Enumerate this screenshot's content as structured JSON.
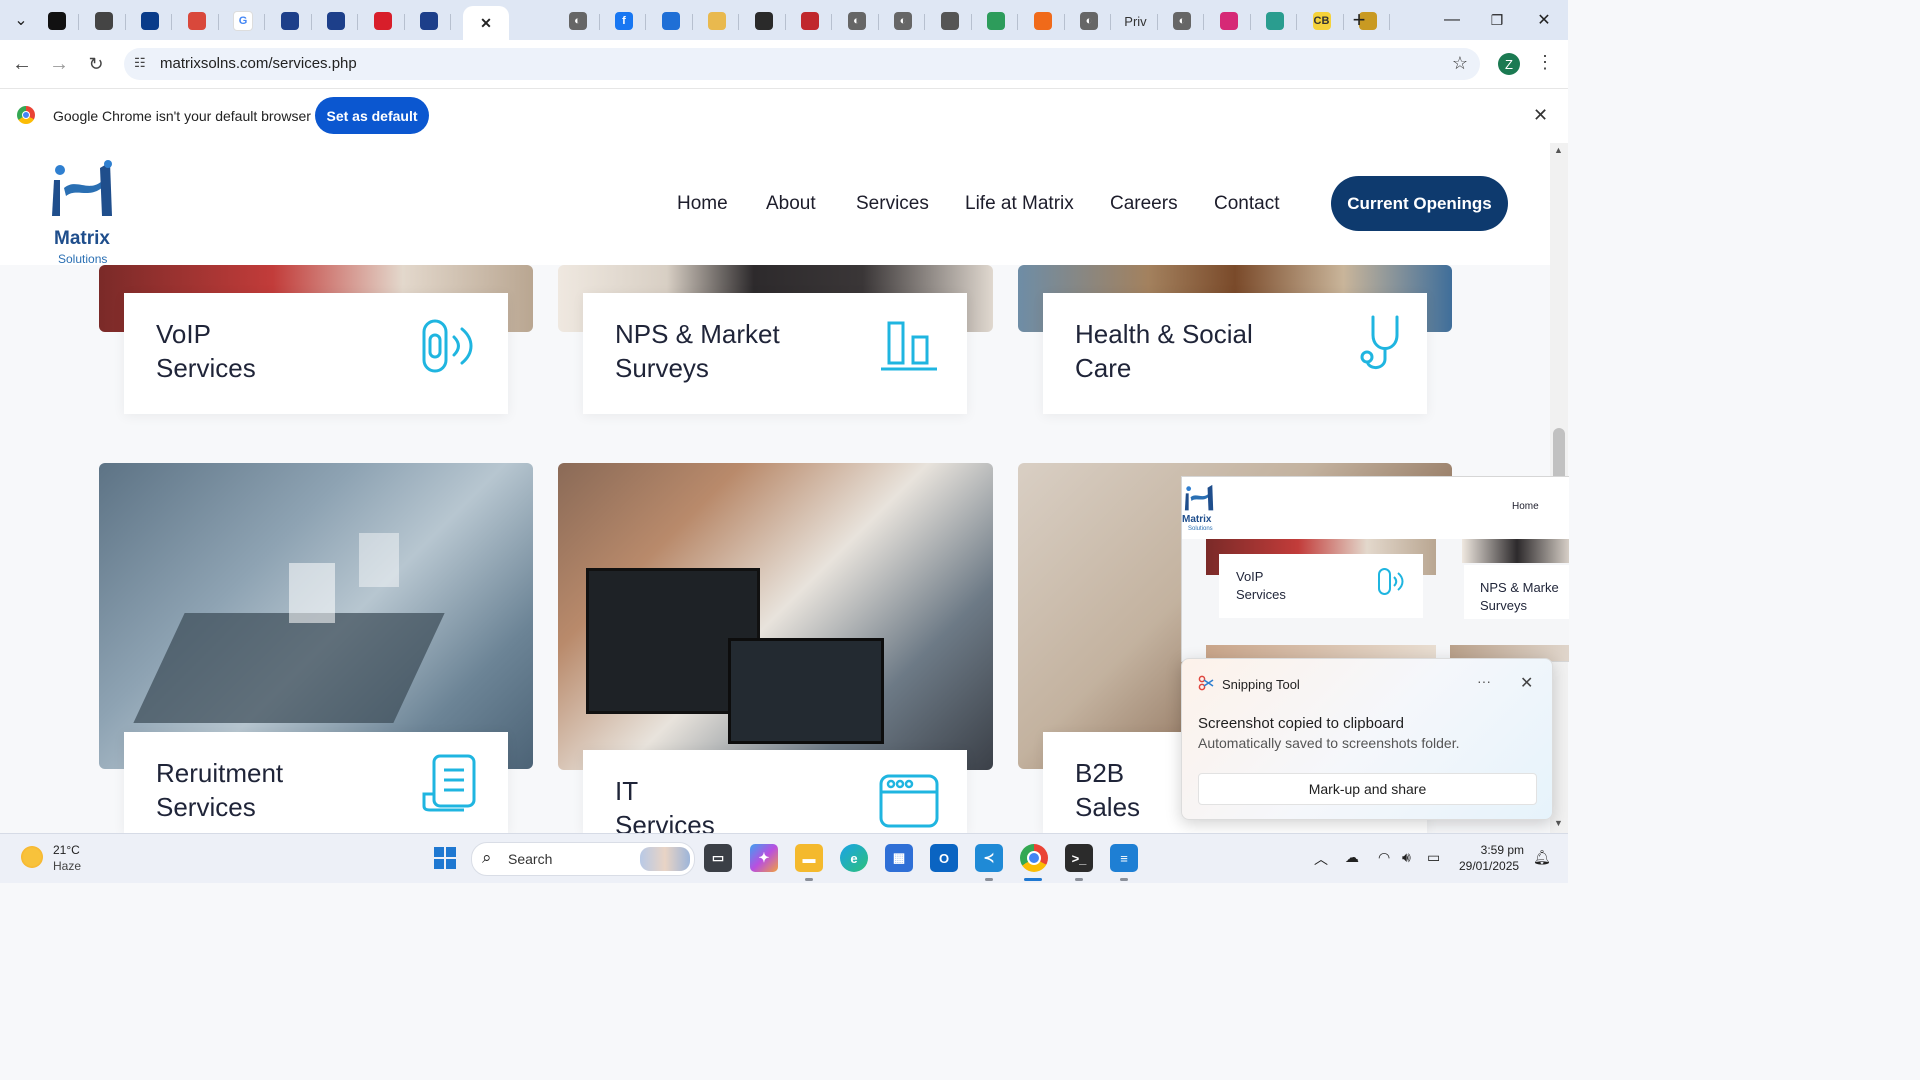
{
  "browser": {
    "tabs": [
      {
        "icon": "chatgpt-icon"
      },
      {
        "icon": "openai-icon"
      },
      {
        "icon": "meta-icon"
      },
      {
        "icon": "puzzle-icon"
      },
      {
        "icon": "google-icon"
      },
      {
        "icon": "copilot-icon"
      },
      {
        "icon": "copilot-icon"
      },
      {
        "icon": "red-app-icon"
      },
      {
        "icon": "copilot-icon"
      },
      {
        "icon": "close-icon",
        "active": true
      },
      {
        "icon": "globe-icon"
      },
      {
        "icon": "facebook-icon"
      },
      {
        "icon": "accessibility-icon"
      },
      {
        "icon": "brand-icon"
      },
      {
        "icon": "calligraphy-icon"
      },
      {
        "icon": "calendar-icon"
      },
      {
        "icon": "globe-icon"
      },
      {
        "icon": "globe-icon"
      },
      {
        "icon": "loading-icon"
      },
      {
        "icon": "map-icon"
      },
      {
        "icon": "orange-app-icon"
      },
      {
        "icon": "globe-icon"
      },
      {
        "icon": "privacy-icon",
        "label": "Priv"
      },
      {
        "icon": "globe-icon"
      },
      {
        "icon": "instagram-icon"
      },
      {
        "icon": "app-icon"
      },
      {
        "icon": "cb-icon",
        "label": "CB"
      },
      {
        "icon": "bird-icon"
      }
    ],
    "url": "matrixsolns.com/services.php",
    "profile_initial": "Z",
    "infobar": {
      "message": "Google Chrome isn't your default browser",
      "button": "Set as default"
    }
  },
  "site": {
    "logo_word": "Matrix",
    "logo_sub": "Solutions",
    "nav": [
      "Home",
      "About",
      "Services",
      "Life at Matrix",
      "Careers",
      "Contact"
    ],
    "cta": "Current Openings",
    "services": [
      {
        "title": "VoIP\nServices",
        "icon": "phone-signal-icon"
      },
      {
        "title": "NPS & Market\nSurveys",
        "icon": "bar-chart-icon"
      },
      {
        "title": "Health & Social\nCare",
        "icon": "stethoscope-icon"
      },
      {
        "title": "Reruitment\nServices",
        "icon": "document-icon"
      },
      {
        "title": "IT\nServices",
        "icon": "browser-window-icon"
      },
      {
        "title": "B2B\nSales",
        "icon": ""
      }
    ]
  },
  "snip_preview": {
    "nav_home": "Home",
    "card1": "VoIP\nServices",
    "card2": "NPS & Marke\nSurveys"
  },
  "toast": {
    "app": "Snipping Tool",
    "more": "···",
    "heading": "Screenshot copied to clipboard",
    "subtext": "Automatically saved to screenshots folder.",
    "button": "Mark-up and share"
  },
  "taskbar": {
    "temperature": "21°C",
    "weather": "Haze",
    "search": "Search",
    "time": "3:59 pm",
    "date": "29/01/2025"
  },
  "colors": {
    "accent_blue": "#0e3a6e",
    "chrome_blue": "#0b57d0",
    "icon_cyan": "#1fb5e0"
  }
}
